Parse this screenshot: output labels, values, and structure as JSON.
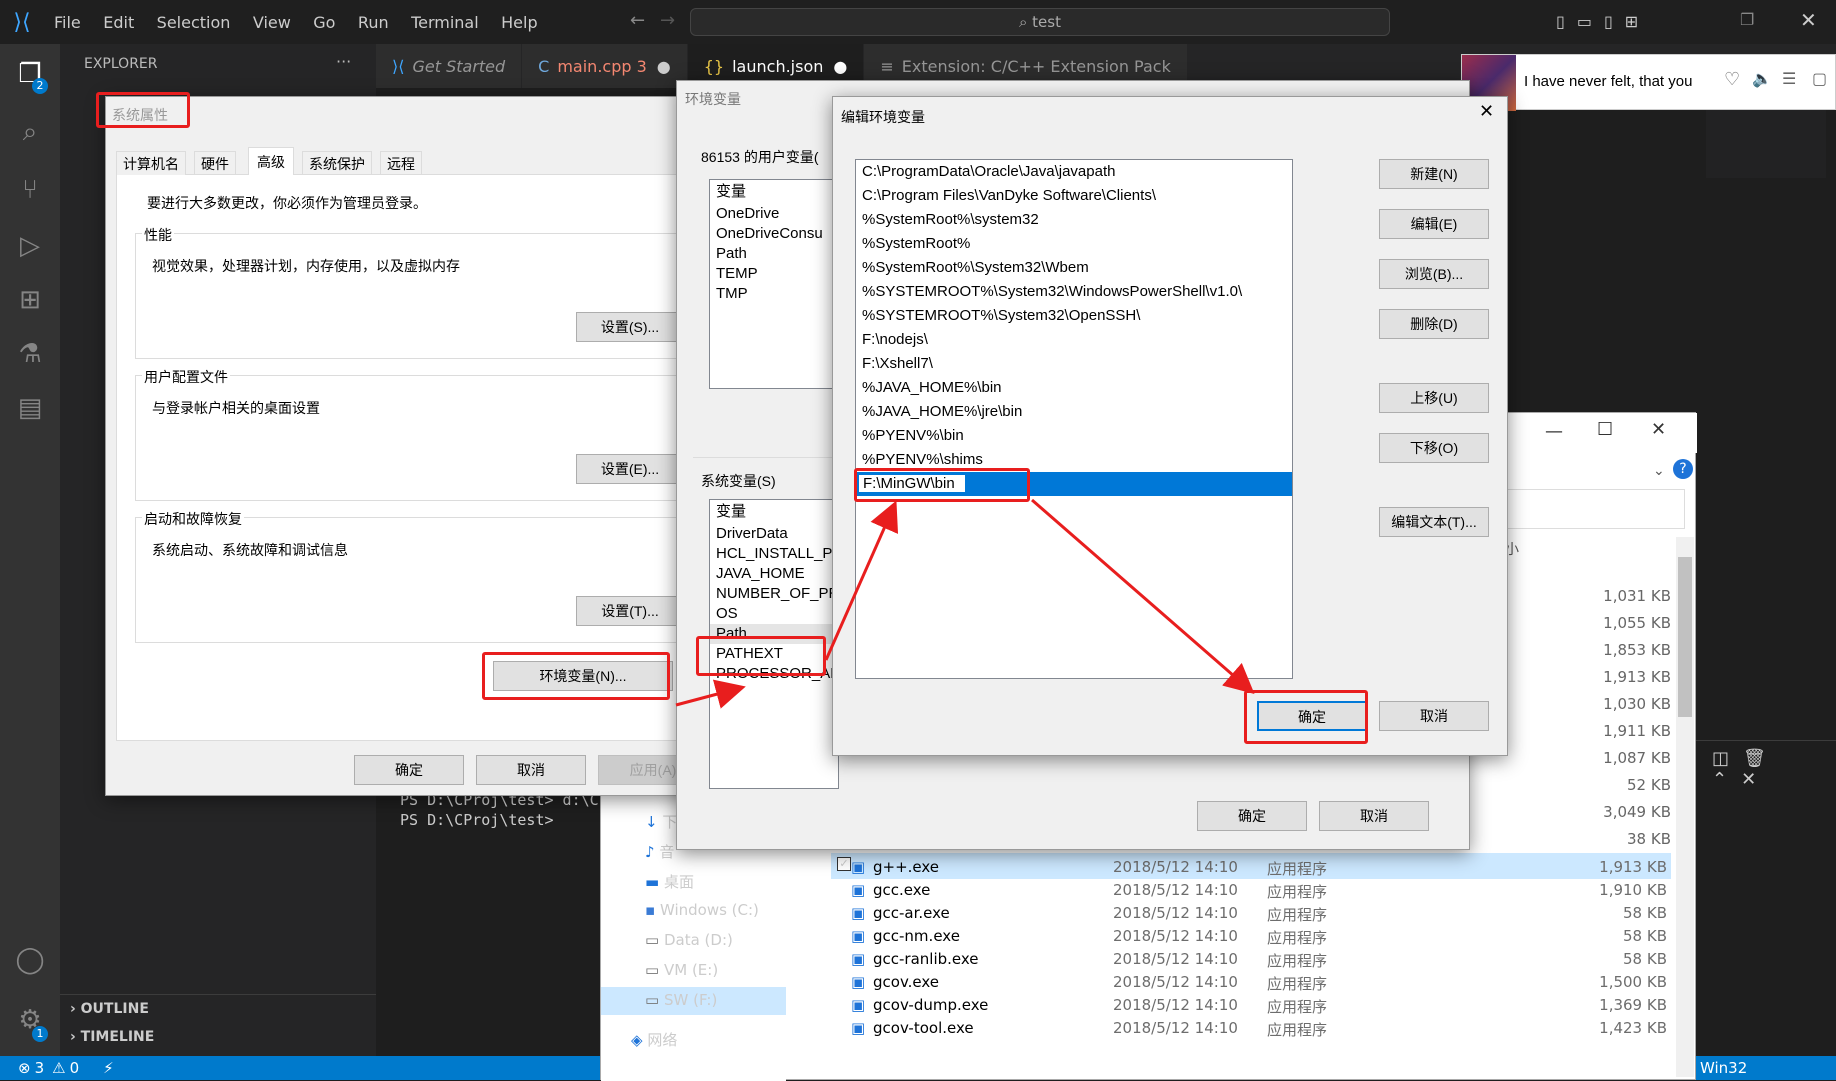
{
  "vscode": {
    "menu": [
      "File",
      "Edit",
      "Selection",
      "View",
      "Go",
      "Run",
      "Terminal",
      "Help"
    ],
    "search": "test",
    "explorer_title": "EXPLORER",
    "explorer_more": "···",
    "tabs": [
      {
        "label": "Get Started",
        "icon": "vscode-icon"
      },
      {
        "label": "main.cpp 3",
        "icon": "cpp-icon"
      },
      {
        "label": "launch.json",
        "icon": "json-icon"
      },
      {
        "label": "Extension: C/C++ Extension Pack",
        "icon": "extension-icon"
      }
    ],
    "terminal_lines": [
      "PS D:\\CProj\\test> d:\\C",
      "PS D:\\CProj\\test>"
    ],
    "outline": "OUTLINE",
    "timeline": "TIMELINE",
    "status": {
      "errors": "3",
      "warnings": "0",
      "right": "Win32"
    },
    "badge_explorer": "2",
    "badge_settings": "1",
    "accent": "#007acc"
  },
  "sysprops": {
    "title": "系统属性",
    "tabs": [
      "计算机名",
      "硬件",
      "高级",
      "系统保护",
      "远程"
    ],
    "admin_note": "要进行大多数更改，你必须作为管理员登录。",
    "perf_label": "性能",
    "perf_desc": "视觉效果，处理器计划，内存使用，以及虚拟内存",
    "perf_btn": "设置(S)...",
    "profile_label": "用户配置文件",
    "profile_desc": "与登录帐户相关的桌面设置",
    "profile_btn": "设置(E)...",
    "startup_label": "启动和故障恢复",
    "startup_desc": "系统启动、系统故障和调试信息",
    "startup_btn": "设置(T)...",
    "env_btn": "环境变量(N)...",
    "ok": "确定",
    "cancel": "取消",
    "apply": "应用(A)"
  },
  "envvars": {
    "title": "环境变量",
    "user_label": "86153 的用户变量(",
    "user_header": "变量",
    "user_vars": [
      "OneDrive",
      "OneDriveConsu",
      "Path",
      "TEMP",
      "TMP"
    ],
    "sys_label": "系统变量(S)",
    "sys_header": "变量",
    "sys_vars": [
      "DriverData",
      "HCL_INSTALL_P",
      "JAVA_HOME",
      "NUMBER_OF_PR",
      "OS",
      "Path",
      "PATHEXT",
      "PROCESSOR_AR"
    ],
    "ok": "确定",
    "cancel": "取消"
  },
  "editenv": {
    "title": "编辑环境变量",
    "paths": [
      "C:\\ProgramData\\Oracle\\Java\\javapath",
      "C:\\Program Files\\VanDyke Software\\Clients\\",
      "%SystemRoot%\\system32",
      "%SystemRoot%",
      "%SystemRoot%\\System32\\Wbem",
      "%SYSTEMROOT%\\System32\\WindowsPowerShell\\v1.0\\",
      "%SYSTEMROOT%\\System32\\OpenSSH\\",
      "F:\\nodejs\\",
      "F:\\Xshell7\\",
      "%JAVA_HOME%\\bin",
      "%JAVA_HOME%\\jre\\bin",
      "%PYENV%\\bin",
      "%PYENV%\\shims",
      "F:\\MinGW\\bin"
    ],
    "buttons": [
      "新建(N)",
      "编辑(E)",
      "浏览(B)...",
      "删除(D)",
      "上移(U)",
      "下移(O)",
      "编辑文本(T)..."
    ],
    "ok": "确定",
    "cancel": "取消"
  },
  "media": {
    "text": "I have never felt, that you"
  },
  "explorer": {
    "nav": [
      "下",
      "音",
      "桌面",
      "Windows (C:)",
      "Data (D:)",
      "VM (E:)",
      "SW (F:)",
      "网络"
    ],
    "sizes_top": [
      "1,031 KB",
      "1,055 KB",
      "1,853 KB",
      "1,913 KB",
      "1,030 KB",
      "1,911 KB",
      "1,087 KB",
      "52 KB",
      "3,049 KB",
      "38 KB"
    ],
    "files": [
      {
        "name": "g++.exe",
        "date": "2018/5/12 14:10",
        "type": "应用程序",
        "size": "1,913 KB"
      },
      {
        "name": "gcc.exe",
        "date": "2018/5/12 14:10",
        "type": "应用程序",
        "size": "1,910 KB"
      },
      {
        "name": "gcc-ar.exe",
        "date": "2018/5/12 14:10",
        "type": "应用程序",
        "size": "58 KB"
      },
      {
        "name": "gcc-nm.exe",
        "date": "2018/5/12 14:10",
        "type": "应用程序",
        "size": "58 KB"
      },
      {
        "name": "gcc-ranlib.exe",
        "date": "2018/5/12 14:10",
        "type": "应用程序",
        "size": "58 KB"
      },
      {
        "name": "gcov.exe",
        "date": "2018/5/12 14:10",
        "type": "应用程序",
        "size": "1,500 KB"
      },
      {
        "name": "gcov-dump.exe",
        "date": "2018/5/12 14:10",
        "type": "应用程序",
        "size": "1,369 KB"
      },
      {
        "name": "gcov-tool.exe",
        "date": "2018/5/12 14:10",
        "type": "应用程序",
        "size": "1,423 KB"
      }
    ],
    "header_partial": "小",
    "help": "?"
  }
}
